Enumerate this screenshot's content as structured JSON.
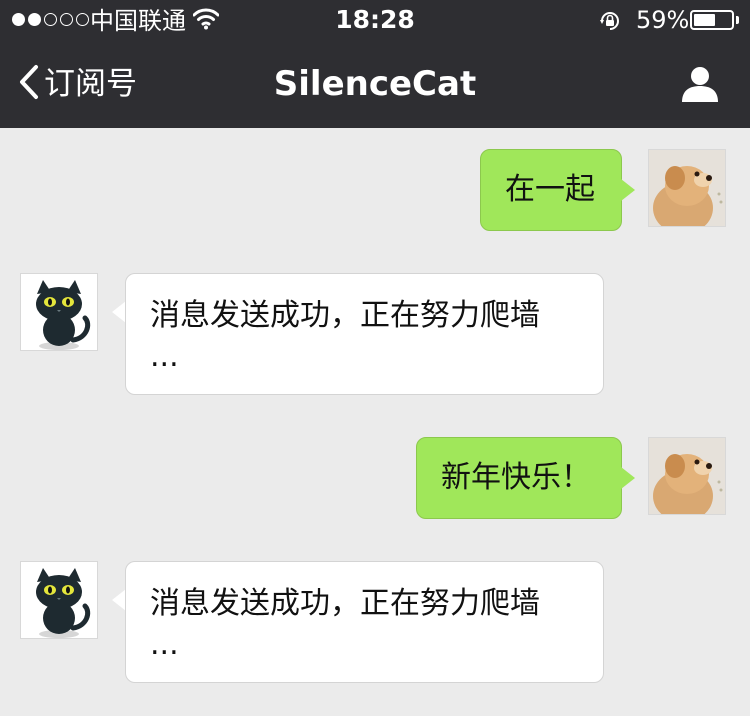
{
  "status_bar": {
    "carrier": "中国联通",
    "time": "18:28",
    "battery_percent": "59%",
    "battery_level": 0.59,
    "signal_strength": 2,
    "signal_max": 5
  },
  "nav": {
    "back_label": "订阅号",
    "title": "SilenceCat",
    "back_icon": "chevron-left-icon",
    "profile_icon": "person-icon"
  },
  "messages": [
    {
      "direction": "outgoing",
      "text": "在一起",
      "avatar": "dog-avatar"
    },
    {
      "direction": "incoming",
      "text": "消息发送成功，正在努力爬墙",
      "text_line2": "...",
      "avatar": "black-cat-avatar"
    },
    {
      "direction": "outgoing",
      "text": "新年快乐！",
      "avatar": "dog-avatar"
    },
    {
      "direction": "incoming",
      "text": "消息发送成功，正在努力爬墙",
      "text_line2": "...",
      "avatar": "black-cat-avatar"
    }
  ],
  "colors": {
    "header_bg": "#2e2e32",
    "chat_bg": "#ebebeb",
    "outgoing_bubble": "#a0e75a",
    "incoming_bubble": "#ffffff"
  }
}
